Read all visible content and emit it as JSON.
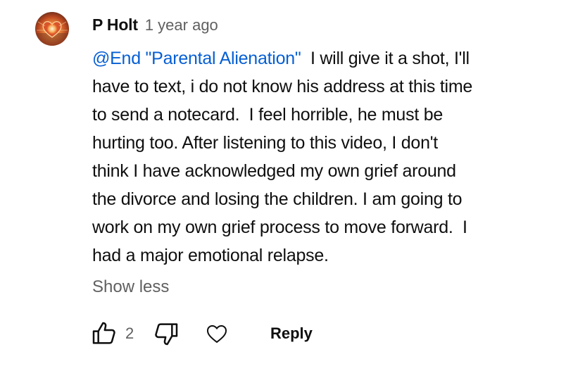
{
  "comment": {
    "author": "P Holt",
    "timestamp": "1 year ago",
    "mention": "@End \"Parental Alienation\"",
    "body_lines": [
      "  I will give it a shot, I'll",
      "have to text, i do not know his address at this time",
      "to send a notecard.  I feel horrible, he must be",
      "hurting too. After listening to this video, I don't",
      "think I have acknowledged my own grief around",
      "the divorce and losing the children. I am going to",
      "work on my own grief process to move forward.  I",
      "had a major emotional relapse."
    ],
    "show_less_label": "Show less",
    "like_count": "2",
    "reply_label": "Reply"
  },
  "colors": {
    "text": "#0f0f0f",
    "secondary": "#606060",
    "mention": "#065fd4"
  },
  "icons": {
    "like": "thumbs-up-icon",
    "dislike": "thumbs-down-icon",
    "heart": "heart-icon"
  }
}
